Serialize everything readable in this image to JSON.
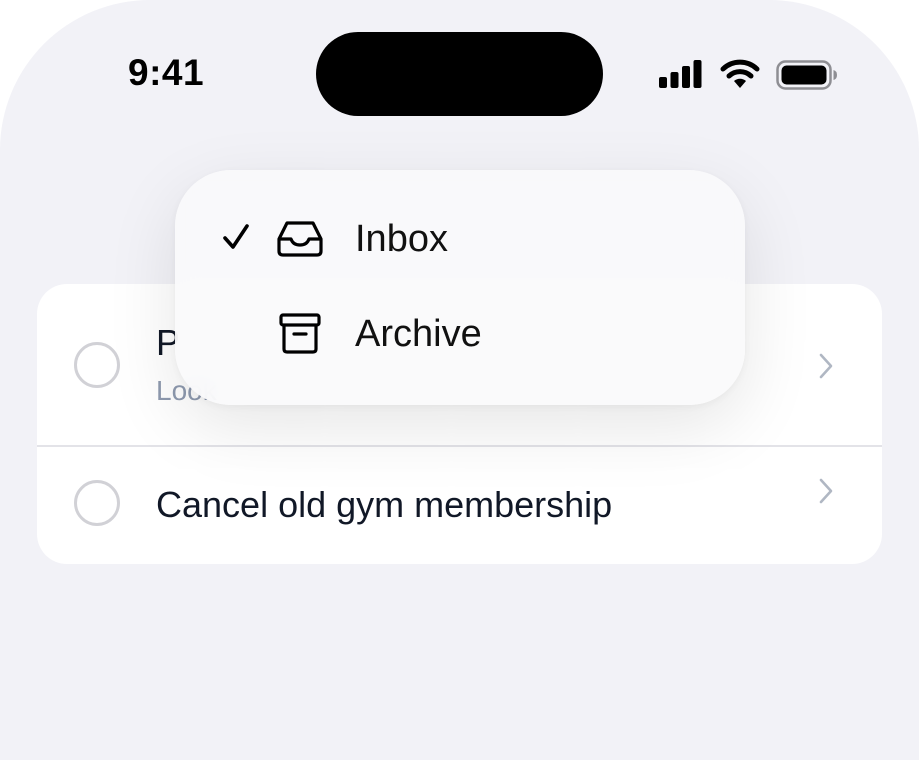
{
  "status_bar": {
    "time": "9:41",
    "icons": [
      "signal-icon",
      "wifi-icon",
      "battery-icon"
    ]
  },
  "tasks": [
    {
      "title": "P",
      "subtitle": "Look",
      "completed": false
    },
    {
      "title": "Cancel old gym membership",
      "completed": false
    }
  ],
  "menu": {
    "items": [
      {
        "label": "Inbox",
        "icon": "inbox-icon",
        "selected": true
      },
      {
        "label": "Archive",
        "icon": "archive-icon",
        "selected": false
      }
    ]
  },
  "colors": {
    "background": "#f2f2f7",
    "card": "#ffffff",
    "title_text": "#111827",
    "subtitle_text": "#8e9aaf",
    "radio_border": "#d1d1d6",
    "chevron": "#b0b7c3"
  }
}
